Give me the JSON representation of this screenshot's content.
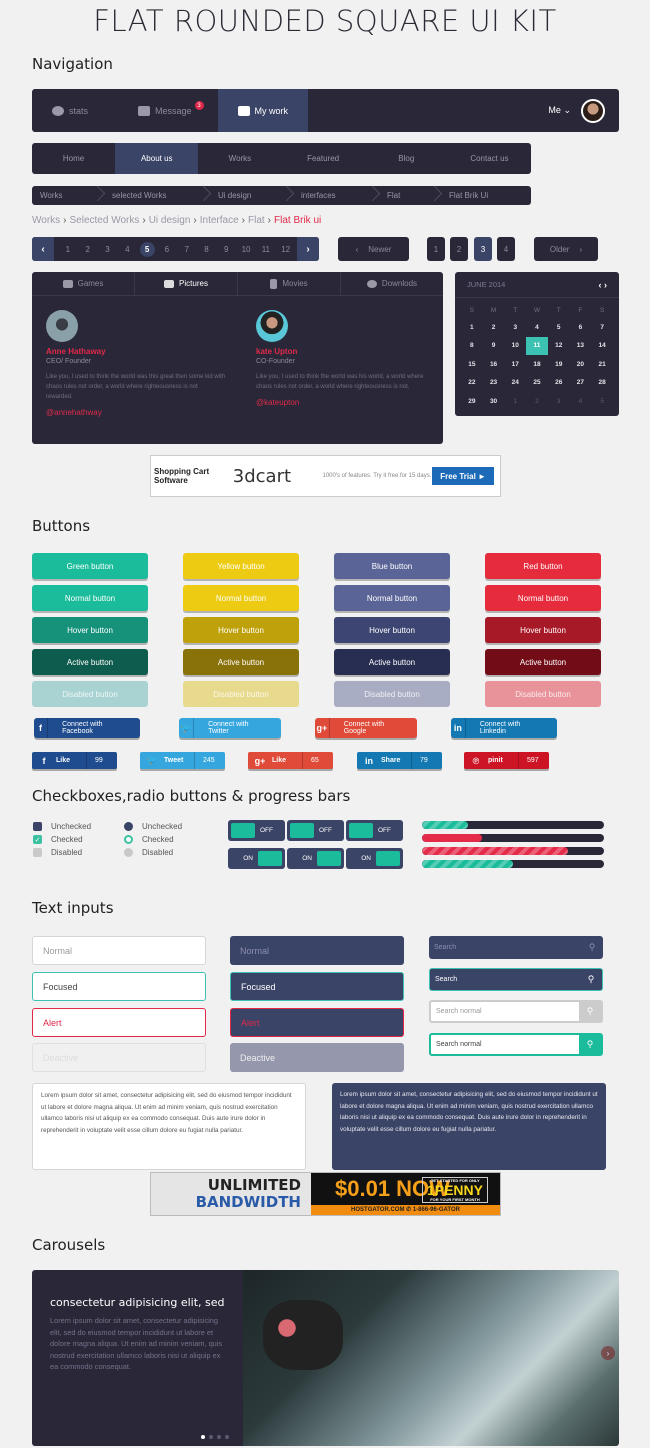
{
  "page_title": "FLAT ROUNDED SQUARE UI KIT",
  "sections": {
    "navigation": "Navigation",
    "buttons": "Buttons",
    "checkboxes": "Checkboxes,radio buttons & progress bars",
    "text_inputs": "Text inputs",
    "carousels": "Carousels"
  },
  "topnav": {
    "items": [
      {
        "label": "stats",
        "icon": "pie-chart-icon"
      },
      {
        "label": "Message",
        "icon": "envelope-icon",
        "badge": "3"
      },
      {
        "label": "My work",
        "icon": "briefcase-icon",
        "active": true
      }
    ],
    "user_label": "Me",
    "user_chevron": "⌄"
  },
  "mainnav": {
    "items": [
      "Home",
      "About us",
      "Works",
      "Featured",
      "Blog",
      "Contact us"
    ],
    "active": "About us"
  },
  "breadcrumb_dark": [
    "Works",
    "selected Works",
    "Ui design",
    "interfaces",
    "Flat",
    "Flat Brik Ui"
  ],
  "breadcrumb_light": {
    "items": [
      "Works",
      "Selected Works",
      "Ui design",
      "Interface",
      "Flat"
    ],
    "current": "Flat Brik ui",
    "separator": "›"
  },
  "pagination": {
    "prev": "‹",
    "next": "›",
    "pages": [
      "1",
      "2",
      "3",
      "4",
      "5",
      "6",
      "7",
      "8",
      "9",
      "10",
      "11",
      "12"
    ],
    "current": "5"
  },
  "pager": {
    "newer": "Newer",
    "older": "Older",
    "newer_arrow": "‹",
    "older_arrow": "›",
    "pages": [
      "1",
      "2",
      "3",
      "4"
    ],
    "current": "3"
  },
  "tabs": {
    "items": [
      {
        "label": "Games",
        "icon": "gamepad-icon"
      },
      {
        "label": "Pictures",
        "icon": "pictures-icon",
        "active": true
      },
      {
        "label": "Movies",
        "icon": "film-icon"
      },
      {
        "label": "Downlods",
        "icon": "cloud-download-icon"
      }
    ],
    "people": [
      {
        "name": "Anne Hathaway",
        "role": "CEO/ Founder",
        "text": "Like you, I used to think the world was this great then some kid with chaos rules not order, a world where righteousness is not rewarded.",
        "handle": "@annehathway"
      },
      {
        "name": "kate Upton",
        "role": "CO-Founder",
        "text": "Like you, I used to think the world was his world, a world where chaos rules not order, a world where righteousness is not.",
        "handle": "@kateupton"
      }
    ]
  },
  "calendar": {
    "month": "JUNE 2014",
    "nav": "‹ ›",
    "weekdays": [
      "S",
      "M",
      "T",
      "W",
      "T",
      "F",
      "S"
    ],
    "days": [
      "1",
      "2",
      "3",
      "4",
      "5",
      "6",
      "7",
      "8",
      "9",
      "10",
      "11",
      "12",
      "13",
      "14",
      "15",
      "16",
      "17",
      "18",
      "19",
      "20",
      "21",
      "22",
      "23",
      "24",
      "25",
      "26",
      "27",
      "28",
      "29",
      "30"
    ],
    "trailing": [
      "1",
      "2",
      "3",
      "4",
      "5"
    ],
    "selected": "11"
  },
  "ad_top": {
    "title": "Shopping Cart Software",
    "logo": "3dcart",
    "desc": "1000's of features. Try it free for 15 days.",
    "cta": "Free Trial ►"
  },
  "buttons": {
    "columns": [
      {
        "name": "green",
        "labels": [
          "Green button",
          "Normal button",
          "Hover button",
          "Active button",
          "Disabled button"
        ],
        "colors": [
          "#1bbc9b",
          "#1bbc9b",
          "#16917a",
          "#0e5c4d",
          "#a9d3d3"
        ]
      },
      {
        "name": "yellow",
        "labels": [
          "Yellow button",
          "Normal button",
          "Hover button",
          "Active button",
          "Disabled button"
        ],
        "colors": [
          "#eccb12",
          "#eccb12",
          "#bfa10c",
          "#8a720a",
          "#e8da8c"
        ]
      },
      {
        "name": "blue",
        "labels": [
          "Blue button",
          "Normal button",
          "Hover button",
          "Active button",
          "Disabled button"
        ],
        "colors": [
          "#5b6496",
          "#5b6496",
          "#3d4673",
          "#272e52",
          "#a9adc4"
        ]
      },
      {
        "name": "red",
        "labels": [
          "Red button",
          "Normal button",
          "Hover button",
          "Active button",
          "Disabled button"
        ],
        "colors": [
          "#e52b3c",
          "#e52b3c",
          "#a81927",
          "#720c16",
          "#e8939a"
        ]
      }
    ]
  },
  "social_connect": [
    {
      "network": "facebook",
      "icon": "f",
      "label": "Connect with Facebook",
      "color": "#1e4c8f"
    },
    {
      "network": "twitter",
      "icon": "🐦",
      "label": "Connect with Twitter",
      "color": "#36a7de"
    },
    {
      "network": "google",
      "icon": "g+",
      "label": "Connect with Google",
      "color": "#e04a39"
    },
    {
      "network": "linkedin",
      "icon": "in",
      "label": "Connect with Linkedin",
      "color": "#1479b2"
    }
  ],
  "social_share": [
    {
      "network": "facebook",
      "icon": "f",
      "label": "Like",
      "count": "99",
      "color": "#1e4c8f"
    },
    {
      "network": "twitter",
      "icon": "🐦",
      "label": "Tweet",
      "count": "245",
      "color": "#36a7de"
    },
    {
      "network": "google",
      "icon": "g+",
      "label": "Like",
      "count": "65",
      "color": "#e04a39"
    },
    {
      "network": "linkedin",
      "icon": "in",
      "label": "Share",
      "count": "79",
      "color": "#1479b2"
    },
    {
      "network": "pinterest",
      "icon": "℗",
      "label": "pinit",
      "count": "597",
      "color": "#cc1424"
    }
  ],
  "checkboxes": [
    {
      "label": "Unchecked",
      "state": "unchecked"
    },
    {
      "label": "Checked",
      "state": "checked"
    },
    {
      "label": "Disabled",
      "state": "disabled"
    }
  ],
  "radios": [
    {
      "label": "Unchecked",
      "state": "unchecked"
    },
    {
      "label": "Checked",
      "state": "checked"
    },
    {
      "label": "Disabled",
      "state": "disabled"
    }
  ],
  "toggles": {
    "off_label": "OFF",
    "on_label": "ON",
    "row1": [
      "off",
      "off",
      "off"
    ],
    "row2": [
      "on",
      "on",
      "on"
    ]
  },
  "progress_bars": [
    {
      "percent": 25,
      "color": "#1bbc9b",
      "striped": true
    },
    {
      "percent": 33,
      "color": "#e52b4a",
      "striped": false
    },
    {
      "percent": 80,
      "color": "#e52b4a",
      "striped": true
    },
    {
      "percent": 50,
      "color": "#1bbc9b",
      "striped": true
    }
  ],
  "inputs_light": [
    {
      "value": "Normal",
      "state": "normal"
    },
    {
      "value": "Focused",
      "state": "focused"
    },
    {
      "value": "Alert",
      "state": "alert"
    },
    {
      "value": "Deactive",
      "state": "deactive"
    }
  ],
  "inputs_dark": [
    {
      "value": "Normal",
      "state": "normal"
    },
    {
      "value": "Focused",
      "state": "focused"
    },
    {
      "value": "Alert",
      "state": "alert"
    },
    {
      "value": "Deactive",
      "state": "deactive"
    }
  ],
  "search_inputs": [
    {
      "placeholder": "Search",
      "style": "dark"
    },
    {
      "placeholder": "Search",
      "style": "dark-focused"
    },
    {
      "placeholder": "Search normal",
      "style": "light"
    },
    {
      "placeholder": "Search normal",
      "style": "light-focused"
    }
  ],
  "search_icon": "⚲",
  "textarea_text": "Lorem ipsum dolor sit amet, consectetur adipisicing elit, sed do eiusmod tempor incididunt ut labore et dolore magna aliqua. Ut enim ad minim veniam, quis nostrud exercitation ullamco laboris nisi ut aliquip ex ea commodo consequat. Duis aute irure dolor in reprehenderit in voluptate velit esse cillum dolore eu fugiat nulla pariatur.",
  "ad_bottom": {
    "line1": "UNLIMITED",
    "line2": "BANDWIDTH",
    "price": "$0.01 NOW",
    "offer_top": "GET STARTED FOR ONLY",
    "offer": "1PENNY",
    "offer_bottom": "FOR YOUR FIRST MONTH",
    "footer": "HOSTGATOR.COM  ✆ 1-866-96-GATOR"
  },
  "carousel": {
    "title": "consectetur adipisicing elit, sed",
    "body": "Lorem ipsum dolor sit amet, consectetur adipisicing elit, sed do eiusmod tempor incididunt ut labore et dolore magna aliqua. Ut enim ad minim veniam, quis nostrud exercitation ullamco laboris nisi ut aliquip ex ea commodo consequat.",
    "slides": 4,
    "active_slide": 1,
    "next": "›"
  }
}
